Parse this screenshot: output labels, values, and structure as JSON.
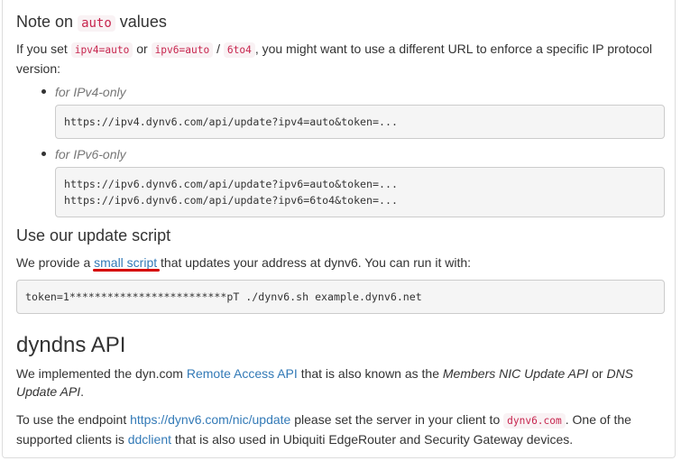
{
  "note_section": {
    "title_pre": "Note on",
    "title_code": "auto",
    "title_post": "values",
    "intro": {
      "t1": "If you set",
      "c1": "ipv4=auto",
      "t2": "or",
      "c2": "ipv6=auto",
      "t3": "/",
      "c3": "6to4",
      "t4": ", you might want to use a different URL to enforce a specific IP protocol version:"
    },
    "items": [
      {
        "label": "for IPv4-only",
        "code": "https://ipv4.dynv6.com/api/update?ipv4=auto&token=..."
      },
      {
        "label": "for IPv6-only",
        "code": "https://ipv6.dynv6.com/api/update?ipv6=auto&token=...\nhttps://ipv6.dynv6.com/api/update?ipv6=6to4&token=..."
      }
    ]
  },
  "script_section": {
    "title": "Use our update script",
    "t1": "We provide a",
    "link": "small script",
    "t2": "that updates your address at dynv6. You can run it with:",
    "code": "token=1*************************pT ./dynv6.sh example.dynv6.net"
  },
  "dyndns_section": {
    "title": "dyndns API",
    "p1": {
      "t1": "We implemented the dyn.com",
      "link": "Remote Access API",
      "t2": "that is also known as the",
      "em1": "Members NIC Update API",
      "t3": "or",
      "em2": "DNS Update API",
      "t4": "."
    },
    "p2": {
      "t1": "To use the endpoint",
      "link1": "https://dynv6.com/nic/update",
      "t2": "please set the server in your client to",
      "code": "dynv6.com",
      "t3": ". One of the supported clients is",
      "link2": "ddclient",
      "t4": "that is also used in Ubiquiti EdgeRouter and Security Gateway devices."
    }
  },
  "colors": {
    "link": "#337ab7",
    "inline_code": "#c7254e",
    "annotation": "#d50000"
  }
}
